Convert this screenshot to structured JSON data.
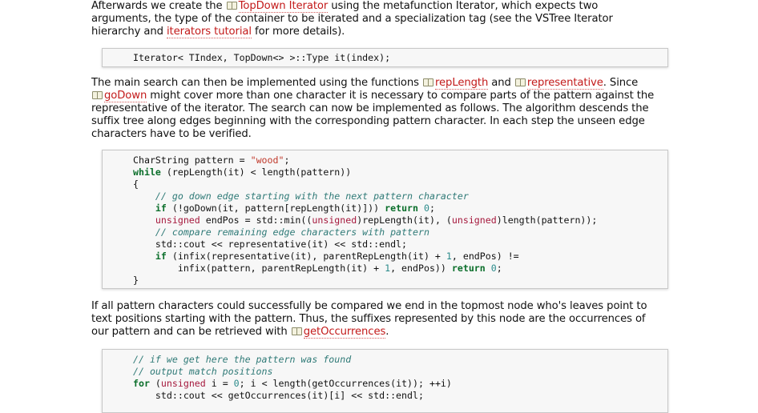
{
  "para1": {
    "l1_a": "Afterwards we create the ",
    "l1_link": "TopDown Iterator",
    "l1_b": " using the metafunction Iterator, which expects two",
    "l2": "arguments, the type of the container to be iterated and a specialization tag (see the VSTree Iterator",
    "l3_a": "hierarchy and ",
    "l3_link": "iterators tutorial",
    "l3_b": " for more details)."
  },
  "code1": {
    "line1": "Iterator< TIndex, TopDown<> >::Type it(index);"
  },
  "para2": {
    "l1_a": "The main search can then be implemented using the functions ",
    "l1_link1": "repLength",
    "l1_b": " and ",
    "l1_link2": "representative",
    "l1_c": ". Since",
    "l2_link": "goDown",
    "l2_b": " might cover more than one character it is necessary to compare parts of the pattern against the",
    "l3": "representative of the iterator. The search can now be implemented as follows. The algorithm descends the",
    "l4": "suffix tree along edges beginning with the corresponding pattern character. In each step the unseen edge",
    "l5": "characters have to be verified."
  },
  "code2": {
    "l1a": "CharString pattern = ",
    "l1str": "\"wood\"",
    "l1b": ";",
    "l2kw": "while",
    "l2b": " (repLength(it) < length(pattern))",
    "l3": "{",
    "l4cm": "    // go down edge starting with the next pattern character",
    "l5kw": "    if",
    "l5b": " (!goDown(it, pattern[repLength(it)])) ",
    "l5kw2": "return",
    "l5num": " 0",
    "l5c": ";",
    "l6ty": "    unsigned",
    "l6b": " endPos = std::min((",
    "l6ty2": "unsigned",
    "l6c": ")repLength(it), (",
    "l6ty3": "unsigned",
    "l6d": ")length(pattern));",
    "l7cm": "    // compare remaining edge characters with pattern",
    "l8": "    std::cout << representative(it) << std::endl;",
    "l9kw": "    if",
    "l9b": " (infix(representative(it), parentRepLength(it) + ",
    "l9num": "1",
    "l9c": ", endPos) !=",
    "l10a": "        infix(pattern, parentRepLength(it) + ",
    "l10num": "1",
    "l10b": ", endPos)) ",
    "l10kw": "return",
    "l10num2": " 0",
    "l10c": ";",
    "l11": "}"
  },
  "para3": {
    "l1": "If all pattern characters could successfully be compared we end in the topmost node who's leaves point to",
    "l2": "text positions starting with the pattern. Thus, the suffixes represented by this node are the occurrences of",
    "l3_a": "our pattern and can be retrieved with ",
    "l3_link": "getOccurrences",
    "l3_b": "."
  },
  "code3": {
    "l1cm": "// if we get here the pattern was found",
    "l2cm": "// output match positions",
    "l3kw": "for",
    "l3a": " (",
    "l3ty": "unsigned",
    "l3b": " i = ",
    "l3num": "0",
    "l3c": "; i < length(getOccurrences(it)); ++i)",
    "l4": "    std::cout << getOccurrences(it)[i] << std::endl;"
  },
  "icons": {
    "doc_link": "book-icon"
  }
}
